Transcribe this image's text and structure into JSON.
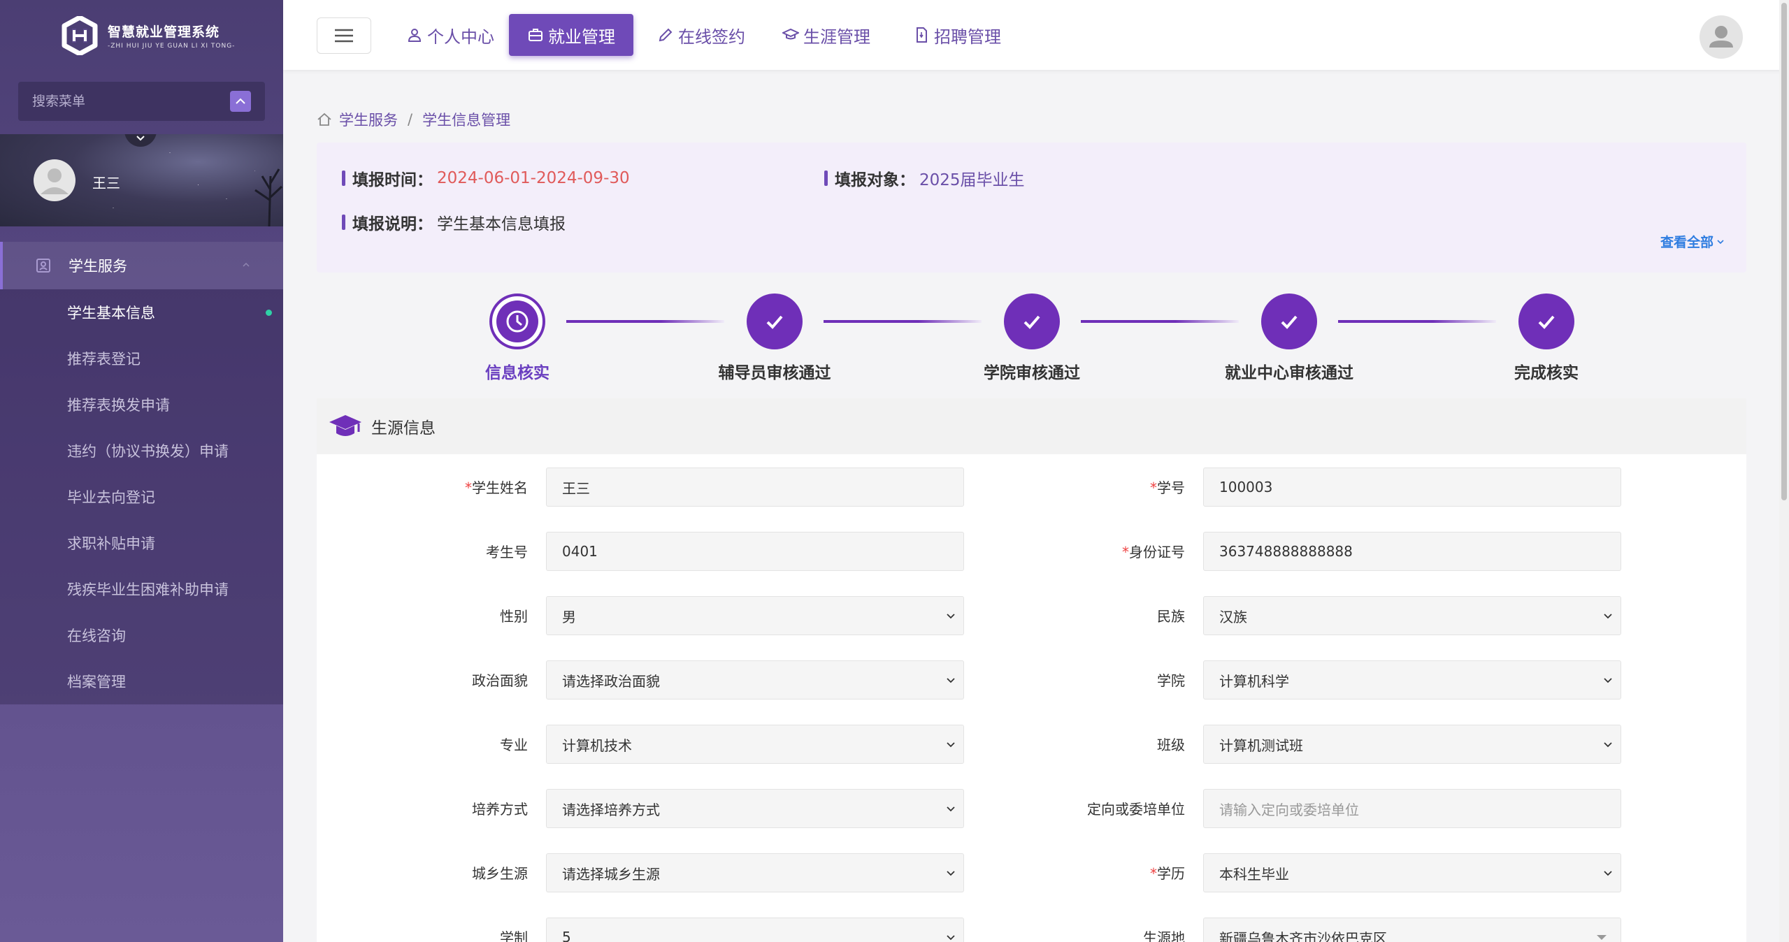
{
  "app": {
    "logo_cn": "智慧就业管理系统",
    "logo_en": "-ZHI HUI JIU YE GUAN LI XI TONG-",
    "menu_search_placeholder": "搜索菜单",
    "username": "王三",
    "accent_color": "#6f4ab8"
  },
  "sidebar": {
    "group": {
      "label": "学生服务",
      "icon": "id-card-icon"
    },
    "items": [
      {
        "label": "学生基本信息",
        "active": true
      },
      {
        "label": "推荐表登记"
      },
      {
        "label": "推荐表换发申请"
      },
      {
        "label": "违约（协议书换发）申请"
      },
      {
        "label": "毕业去向登记"
      },
      {
        "label": "求职补贴申请"
      },
      {
        "label": "残疾毕业生困难补助申请"
      },
      {
        "label": "在线咨询"
      },
      {
        "label": "档案管理"
      }
    ]
  },
  "topnav": [
    {
      "label": "个人中心",
      "icon": "user-icon"
    },
    {
      "label": "就业管理",
      "icon": "briefcase-icon",
      "active": true
    },
    {
      "label": "在线签约",
      "icon": "pen-icon"
    },
    {
      "label": "生涯管理",
      "icon": "graduation-cap-icon"
    },
    {
      "label": "招聘管理",
      "icon": "document-icon"
    }
  ],
  "breadcrumb": {
    "root": "学生服务",
    "sep": "/",
    "current": "学生信息管理"
  },
  "info": {
    "time_label": "填报时间：",
    "time_value": "2024-06-01-2024-09-30",
    "target_label": "填报对象：",
    "target_value": "2025届毕业生",
    "desc_label": "填报说明：",
    "desc_value": "学生基本信息填报",
    "view_all": "查看全部"
  },
  "steps": [
    {
      "label": "信息核实",
      "state": "current"
    },
    {
      "label": "辅导员审核通过",
      "state": "done"
    },
    {
      "label": "学院审核通过",
      "state": "done"
    },
    {
      "label": "就业中心审核通过",
      "state": "done"
    },
    {
      "label": "完成核实",
      "state": "done"
    }
  ],
  "form": {
    "section_title": "生源信息",
    "required_mark": "*",
    "fields": {
      "student_name": {
        "label": "学生姓名",
        "value": "王三"
      },
      "student_id": {
        "label": "学号",
        "value": "100003"
      },
      "exam_no": {
        "label": "考生号",
        "value": "0401"
      },
      "id_card": {
        "label": "身份证号",
        "value": "363748888888888"
      },
      "gender": {
        "label": "性别",
        "value": "男"
      },
      "ethnicity": {
        "label": "民族",
        "value": "汉族"
      },
      "political": {
        "label": "政治面貌",
        "value": "请选择政治面貌"
      },
      "college": {
        "label": "学院",
        "value": "计算机科学"
      },
      "major": {
        "label": "专业",
        "value": "计算机技术"
      },
      "class": {
        "label": "班级",
        "value": "计算机测试班"
      },
      "training_mode": {
        "label": "培养方式",
        "value": "请选择培养方式"
      },
      "sponsor_unit": {
        "label": "定向或委培单位",
        "placeholder": "请输入定向或委培单位"
      },
      "urban_rural": {
        "label": "城乡生源",
        "value": "请选择城乡生源"
      },
      "education": {
        "label": "学历",
        "value": "本科生毕业"
      },
      "duration": {
        "label": "学制",
        "value": "5"
      },
      "origin": {
        "label": "生源地",
        "value": "新疆乌鲁木齐市沙依巴克区"
      }
    }
  }
}
